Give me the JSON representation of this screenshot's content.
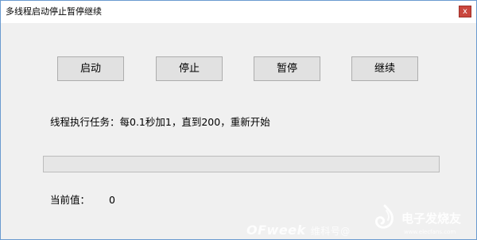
{
  "window": {
    "title": "多线程启动停止暂停继续",
    "close_glyph": "x"
  },
  "buttons": {
    "start": "启动",
    "stop": "停止",
    "pause": "暂停",
    "continue": "继续"
  },
  "task": {
    "description": "线程执行任务：每0.1秒加1，直到200，重新开始"
  },
  "progress": {
    "fraction": 0
  },
  "current": {
    "label": "当前值：",
    "value": "0"
  },
  "watermark": {
    "left_brand": "OFweek",
    "left_text": "维科号",
    "left_at": "@",
    "right_brand": "电子发烧友",
    "url": "www.elecfans.com"
  },
  "colors": {
    "window_bg": "#f0f0f0",
    "titlebar_bg": "#ffffff",
    "close_bg": "#c9463d",
    "button_bg": "#e1e1e1",
    "progress_fill": "#06b025"
  }
}
